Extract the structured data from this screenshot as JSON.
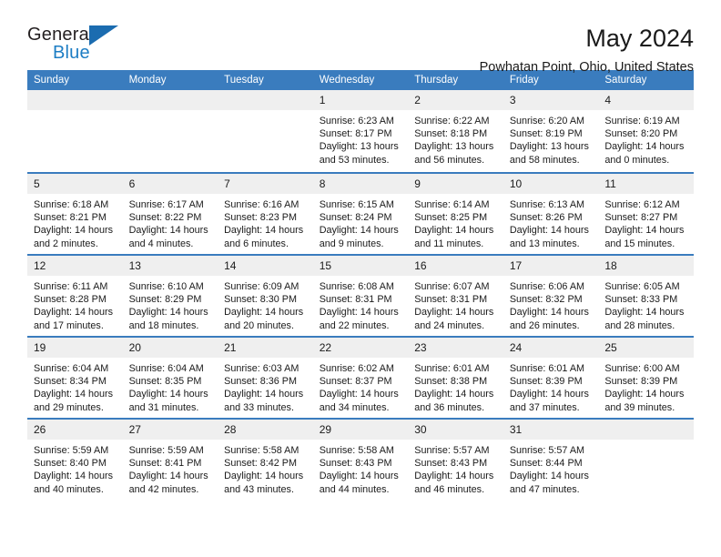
{
  "brand": {
    "line1": "General",
    "line2": "Blue",
    "icon": "blue-triangle-logo",
    "accent_color": "#1b6cb0"
  },
  "header": {
    "month_title": "May 2024",
    "location": "Powhatan Point, Ohio, United States"
  },
  "theme": {
    "header_blue": "#3a7cbe",
    "daynum_gray": "#efefef",
    "text": "#1a1a1a"
  },
  "calendar": {
    "weekday_headers": [
      "Sunday",
      "Monday",
      "Tuesday",
      "Wednesday",
      "Thursday",
      "Friday",
      "Saturday"
    ],
    "labels": {
      "sunrise": "Sunrise:",
      "sunset": "Sunset:",
      "daylight": "Daylight:"
    },
    "weeks": [
      {
        "days": [
          {
            "num": "",
            "empty": true
          },
          {
            "num": "",
            "empty": true
          },
          {
            "num": "",
            "empty": true
          },
          {
            "num": "1",
            "sunrise": "Sunrise: 6:23 AM",
            "sunset": "Sunset: 8:17 PM",
            "daylight_1": "Daylight: 13 hours",
            "daylight_2": "and 53 minutes."
          },
          {
            "num": "2",
            "sunrise": "Sunrise: 6:22 AM",
            "sunset": "Sunset: 8:18 PM",
            "daylight_1": "Daylight: 13 hours",
            "daylight_2": "and 56 minutes."
          },
          {
            "num": "3",
            "sunrise": "Sunrise: 6:20 AM",
            "sunset": "Sunset: 8:19 PM",
            "daylight_1": "Daylight: 13 hours",
            "daylight_2": "and 58 minutes."
          },
          {
            "num": "4",
            "sunrise": "Sunrise: 6:19 AM",
            "sunset": "Sunset: 8:20 PM",
            "daylight_1": "Daylight: 14 hours",
            "daylight_2": "and 0 minutes."
          }
        ]
      },
      {
        "days": [
          {
            "num": "5",
            "sunrise": "Sunrise: 6:18 AM",
            "sunset": "Sunset: 8:21 PM",
            "daylight_1": "Daylight: 14 hours",
            "daylight_2": "and 2 minutes."
          },
          {
            "num": "6",
            "sunrise": "Sunrise: 6:17 AM",
            "sunset": "Sunset: 8:22 PM",
            "daylight_1": "Daylight: 14 hours",
            "daylight_2": "and 4 minutes."
          },
          {
            "num": "7",
            "sunrise": "Sunrise: 6:16 AM",
            "sunset": "Sunset: 8:23 PM",
            "daylight_1": "Daylight: 14 hours",
            "daylight_2": "and 6 minutes."
          },
          {
            "num": "8",
            "sunrise": "Sunrise: 6:15 AM",
            "sunset": "Sunset: 8:24 PM",
            "daylight_1": "Daylight: 14 hours",
            "daylight_2": "and 9 minutes."
          },
          {
            "num": "9",
            "sunrise": "Sunrise: 6:14 AM",
            "sunset": "Sunset: 8:25 PM",
            "daylight_1": "Daylight: 14 hours",
            "daylight_2": "and 11 minutes."
          },
          {
            "num": "10",
            "sunrise": "Sunrise: 6:13 AM",
            "sunset": "Sunset: 8:26 PM",
            "daylight_1": "Daylight: 14 hours",
            "daylight_2": "and 13 minutes."
          },
          {
            "num": "11",
            "sunrise": "Sunrise: 6:12 AM",
            "sunset": "Sunset: 8:27 PM",
            "daylight_1": "Daylight: 14 hours",
            "daylight_2": "and 15 minutes."
          }
        ]
      },
      {
        "days": [
          {
            "num": "12",
            "sunrise": "Sunrise: 6:11 AM",
            "sunset": "Sunset: 8:28 PM",
            "daylight_1": "Daylight: 14 hours",
            "daylight_2": "and 17 minutes."
          },
          {
            "num": "13",
            "sunrise": "Sunrise: 6:10 AM",
            "sunset": "Sunset: 8:29 PM",
            "daylight_1": "Daylight: 14 hours",
            "daylight_2": "and 18 minutes."
          },
          {
            "num": "14",
            "sunrise": "Sunrise: 6:09 AM",
            "sunset": "Sunset: 8:30 PM",
            "daylight_1": "Daylight: 14 hours",
            "daylight_2": "and 20 minutes."
          },
          {
            "num": "15",
            "sunrise": "Sunrise: 6:08 AM",
            "sunset": "Sunset: 8:31 PM",
            "daylight_1": "Daylight: 14 hours",
            "daylight_2": "and 22 minutes."
          },
          {
            "num": "16",
            "sunrise": "Sunrise: 6:07 AM",
            "sunset": "Sunset: 8:31 PM",
            "daylight_1": "Daylight: 14 hours",
            "daylight_2": "and 24 minutes."
          },
          {
            "num": "17",
            "sunrise": "Sunrise: 6:06 AM",
            "sunset": "Sunset: 8:32 PM",
            "daylight_1": "Daylight: 14 hours",
            "daylight_2": "and 26 minutes."
          },
          {
            "num": "18",
            "sunrise": "Sunrise: 6:05 AM",
            "sunset": "Sunset: 8:33 PM",
            "daylight_1": "Daylight: 14 hours",
            "daylight_2": "and 28 minutes."
          }
        ]
      },
      {
        "days": [
          {
            "num": "19",
            "sunrise": "Sunrise: 6:04 AM",
            "sunset": "Sunset: 8:34 PM",
            "daylight_1": "Daylight: 14 hours",
            "daylight_2": "and 29 minutes."
          },
          {
            "num": "20",
            "sunrise": "Sunrise: 6:04 AM",
            "sunset": "Sunset: 8:35 PM",
            "daylight_1": "Daylight: 14 hours",
            "daylight_2": "and 31 minutes."
          },
          {
            "num": "21",
            "sunrise": "Sunrise: 6:03 AM",
            "sunset": "Sunset: 8:36 PM",
            "daylight_1": "Daylight: 14 hours",
            "daylight_2": "and 33 minutes."
          },
          {
            "num": "22",
            "sunrise": "Sunrise: 6:02 AM",
            "sunset": "Sunset: 8:37 PM",
            "daylight_1": "Daylight: 14 hours",
            "daylight_2": "and 34 minutes."
          },
          {
            "num": "23",
            "sunrise": "Sunrise: 6:01 AM",
            "sunset": "Sunset: 8:38 PM",
            "daylight_1": "Daylight: 14 hours",
            "daylight_2": "and 36 minutes."
          },
          {
            "num": "24",
            "sunrise": "Sunrise: 6:01 AM",
            "sunset": "Sunset: 8:39 PM",
            "daylight_1": "Daylight: 14 hours",
            "daylight_2": "and 37 minutes."
          },
          {
            "num": "25",
            "sunrise": "Sunrise: 6:00 AM",
            "sunset": "Sunset: 8:39 PM",
            "daylight_1": "Daylight: 14 hours",
            "daylight_2": "and 39 minutes."
          }
        ]
      },
      {
        "days": [
          {
            "num": "26",
            "sunrise": "Sunrise: 5:59 AM",
            "sunset": "Sunset: 8:40 PM",
            "daylight_1": "Daylight: 14 hours",
            "daylight_2": "and 40 minutes."
          },
          {
            "num": "27",
            "sunrise": "Sunrise: 5:59 AM",
            "sunset": "Sunset: 8:41 PM",
            "daylight_1": "Daylight: 14 hours",
            "daylight_2": "and 42 minutes."
          },
          {
            "num": "28",
            "sunrise": "Sunrise: 5:58 AM",
            "sunset": "Sunset: 8:42 PM",
            "daylight_1": "Daylight: 14 hours",
            "daylight_2": "and 43 minutes."
          },
          {
            "num": "29",
            "sunrise": "Sunrise: 5:58 AM",
            "sunset": "Sunset: 8:43 PM",
            "daylight_1": "Daylight: 14 hours",
            "daylight_2": "and 44 minutes."
          },
          {
            "num": "30",
            "sunrise": "Sunrise: 5:57 AM",
            "sunset": "Sunset: 8:43 PM",
            "daylight_1": "Daylight: 14 hours",
            "daylight_2": "and 46 minutes."
          },
          {
            "num": "31",
            "sunrise": "Sunrise: 5:57 AM",
            "sunset": "Sunset: 8:44 PM",
            "daylight_1": "Daylight: 14 hours",
            "daylight_2": "and 47 minutes."
          },
          {
            "num": "",
            "empty": true
          }
        ]
      }
    ]
  }
}
